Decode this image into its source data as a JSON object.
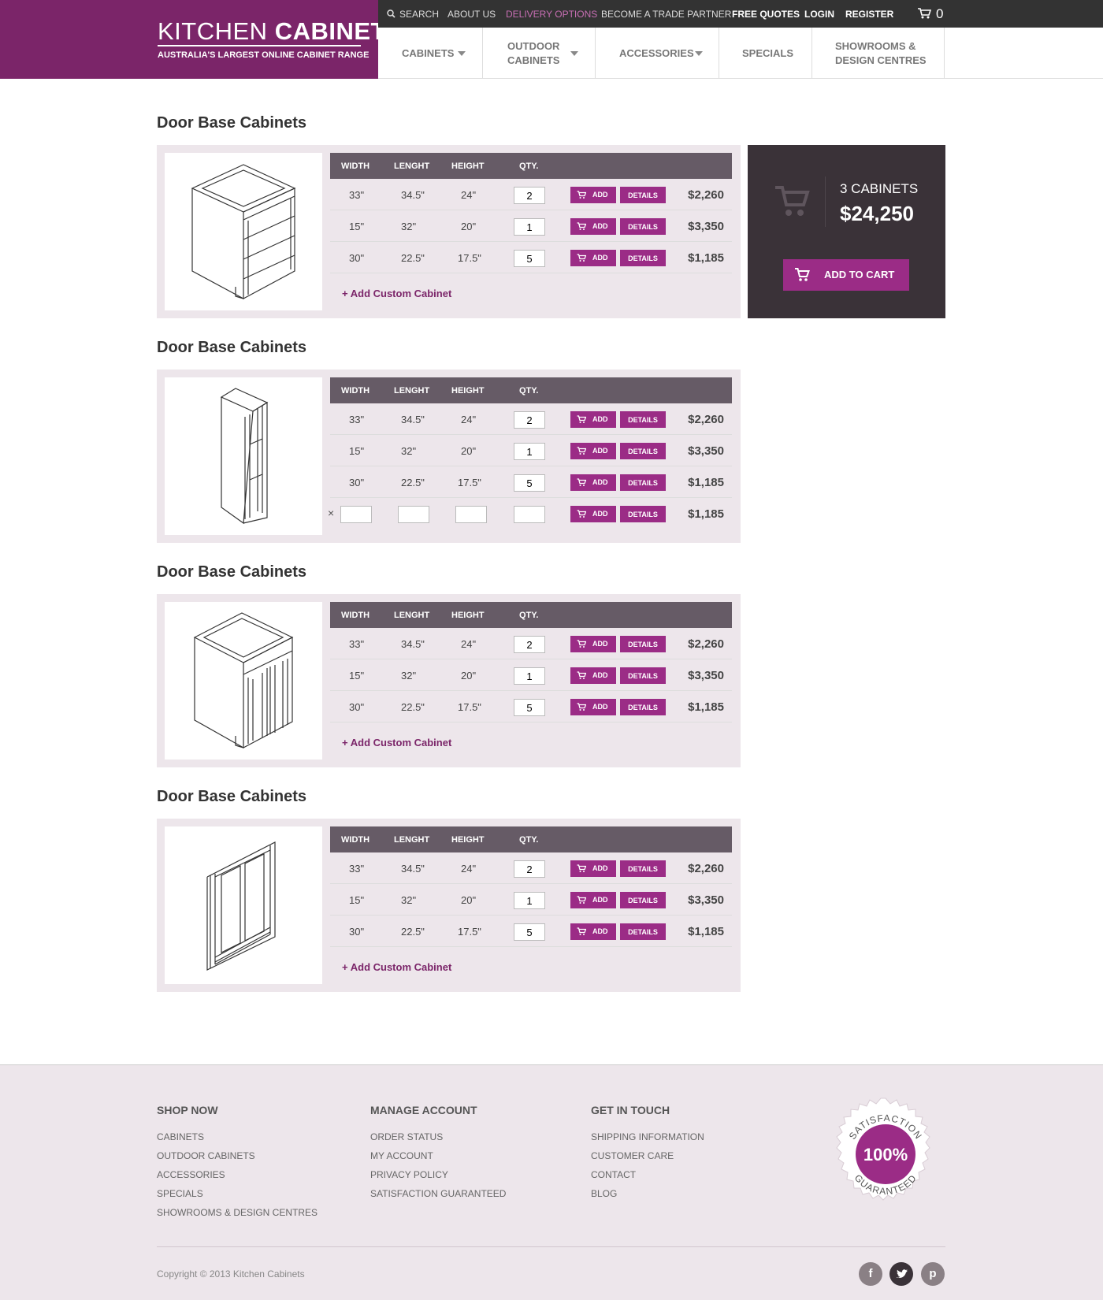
{
  "brand": {
    "title_light": "KITCHEN",
    "title_bold": "CABINETS",
    "tagline": "AUSTRALIA'S LARGEST ONLINE CABINET RANGE",
    "color": "#7b2569"
  },
  "topbar": {
    "search": "SEARCH",
    "about": "ABOUT US",
    "delivery": "DELIVERY OPTIONS",
    "trade": "BECOME A TRADE PARTNER",
    "quotes": "FREE QUOTES",
    "login": "LOGIN",
    "register": "REGISTER",
    "cart_count": "0"
  },
  "nav": {
    "cabinets": "CABINETS",
    "outdoor_1": "OUTDOOR",
    "outdoor_2": "CABINETS",
    "accessories": "ACCESSORIES",
    "specials": "SPECIALS",
    "showrooms_1": "SHOWROOMS &",
    "showrooms_2": "DESIGN CENTRES"
  },
  "table_headers": {
    "width": "WIDTH",
    "length": "LENGHT",
    "height": "HEIGHT",
    "qty": "QTY."
  },
  "buttons": {
    "add": "ADD",
    "details": "DETAILS",
    "custom": "Add Custom Cabinet"
  },
  "products": [
    {
      "title": "Door Base Cabinets",
      "icon": "drawer-cabinet-icon",
      "rows": [
        {
          "width": "33\"",
          "length": "34.5\"",
          "height": "24\"",
          "qty": "2",
          "price": "$2,260"
        },
        {
          "width": "15\"",
          "length": "32\"",
          "height": "20\"",
          "qty": "1",
          "price": "$3,350"
        },
        {
          "width": "30\"",
          "length": "22.5\"",
          "height": "17.5\"",
          "qty": "5",
          "price": "$1,185"
        }
      ]
    },
    {
      "title": "Door Base Cabinets",
      "icon": "tall-pantry-cabinet-icon",
      "rows": [
        {
          "width": "33\"",
          "length": "34.5\"",
          "height": "24\"",
          "qty": "2",
          "price": "$2,260"
        },
        {
          "width": "15\"",
          "length": "32\"",
          "height": "20\"",
          "qty": "1",
          "price": "$3,350"
        },
        {
          "width": "30\"",
          "length": "22.5\"",
          "height": "17.5\"",
          "qty": "5",
          "price": "$1,185"
        }
      ],
      "custom_row": {
        "remove": "×",
        "price": "$1,185"
      }
    },
    {
      "title": "Door Base Cabinets",
      "icon": "door-base-cabinet-icon",
      "rows": [
        {
          "width": "33\"",
          "length": "34.5\"",
          "height": "24\"",
          "qty": "2",
          "price": "$2,260"
        },
        {
          "width": "15\"",
          "length": "32\"",
          "height": "20\"",
          "qty": "1",
          "price": "$3,350"
        },
        {
          "width": "30\"",
          "length": "22.5\"",
          "height": "17.5\"",
          "qty": "5",
          "price": "$1,185"
        }
      ]
    },
    {
      "title": "Door Base Cabinets",
      "icon": "cabinet-door-panel-icon",
      "rows": [
        {
          "width": "33\"",
          "length": "34.5\"",
          "height": "24\"",
          "qty": "2",
          "price": "$2,260"
        },
        {
          "width": "15\"",
          "length": "32\"",
          "height": "20\"",
          "qty": "1",
          "price": "$3,350"
        },
        {
          "width": "30\"",
          "length": "22.5\"",
          "height": "17.5\"",
          "qty": "5",
          "price": "$1,185"
        }
      ]
    }
  ],
  "summary": {
    "count": "3 CABINETS",
    "total": "$24,250",
    "button": "ADD TO CART"
  },
  "footer": {
    "shop_title": "SHOP NOW",
    "shop": [
      "CABINETS",
      "OUTDOOR CABINETS",
      "ACCESSORIES",
      "SPECIALS",
      "SHOWROOMS & DESIGN CENTRES"
    ],
    "account_title": "MANAGE ACCOUNT",
    "account": [
      "ORDER STATUS",
      "MY ACCOUNT",
      "PRIVACY POLICY",
      "SATISFACTION GUARANTEED"
    ],
    "contact_title": "GET IN TOUCH",
    "contact": [
      "SHIPPING INFORMATION",
      "CUSTOMER CARE",
      "CONTACT",
      "BLOG"
    ],
    "badge_top": "SATISFACTION",
    "badge_pct": "100%",
    "badge_bottom": "GUARANTEED",
    "copyright": "Copyright © 2013 Kitchen Cabinets",
    "social": [
      "facebook-icon",
      "twitter-icon",
      "pinterest-icon"
    ]
  }
}
